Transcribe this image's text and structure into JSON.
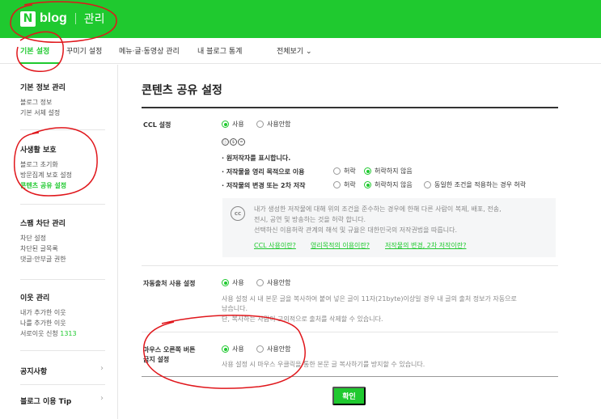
{
  "header": {
    "logo_letter": "N",
    "logo_text": "blog",
    "section": "관리"
  },
  "nav": {
    "tabs": [
      "기본 설정",
      "꾸미기 설정",
      "메뉴·글·동영상 관리",
      "내 블로그 통계",
      "전체보기"
    ]
  },
  "sidebar": {
    "groups": [
      {
        "title": "기본 정보 관리",
        "items": [
          "블로그 정보",
          "기본 서체 설정"
        ]
      },
      {
        "title": "사생활 보호",
        "items": [
          "블로그 초기화",
          "방문집계 보호 설정",
          "콘텐츠 공유 설정"
        ]
      },
      {
        "title": "스팸 차단 관리",
        "items": [
          "차단 설정",
          "차단된 글목록",
          "댓글·안부글 권한"
        ]
      },
      {
        "title": "이웃 관리",
        "items": [
          "내가 추가한 이웃",
          "나를 추가한 이웃",
          "서로이웃 신청"
        ]
      }
    ],
    "neighbor_request_count": "1313",
    "notice": "공지사항",
    "usage_tip": "블로그 이용 Tip"
  },
  "page": {
    "title": "콘텐츠 공유 설정"
  },
  "ccl": {
    "label": "CCL 설정",
    "use": "사용",
    "nouse": "사용안함",
    "icons": [
      "ⓘ",
      "$",
      "="
    ],
    "line1": "· 원저작자를 표시합니다.",
    "line2": "· 저작물을 영리 목적으로 이용",
    "allow": "허락",
    "disallow": "허락하지 않음",
    "line3": "· 저작물의 변경 또는 2차 저작",
    "same": "동일한 조건을 적용하는 경우 허락",
    "cc_icon": "cc",
    "info1": "내가 생성한 저작물에 대해 위의 조건을 준수하는 경우에 한해 다른 사람이 복제, 배포, 전송,",
    "info2": "전시, 공연 및 방송하는 것을 허락 합니다.",
    "info3": "선택하신 이용허락 관계의 해석 및 규율은 대한민국의 저작권법을 따릅니다.",
    "link1": "CCL 사용이란?",
    "link2": "영리목적의 이용이란?",
    "link3": "저작물의 변경, 2차 저작이란?"
  },
  "auto": {
    "label": "자동출처 사용 설정",
    "use": "사용",
    "nouse": "사용안함",
    "desc1": "사용 설정 시 내 본문 글을 복사하여 붙여 넣은 글이 11자(21byte)이상일 경우 내 글의 출처 정보가 자동으로",
    "desc2": "남습니다.",
    "desc3": "단, 복사하는 사람이 고의적으로 출처를 삭제할 수 있습니다."
  },
  "rclick": {
    "label1": "마우스 오른쪽 버튼",
    "label2": "금지 설정",
    "use": "사용",
    "nouse": "사용안함",
    "desc": "사용 설정 시 마우스 우클릭을 통한 본문 글 복사하기를 방지할 수 있습니다."
  },
  "confirm": "확인",
  "colors": {
    "brand": "#1fc92f",
    "annotation": "#e0161b"
  }
}
